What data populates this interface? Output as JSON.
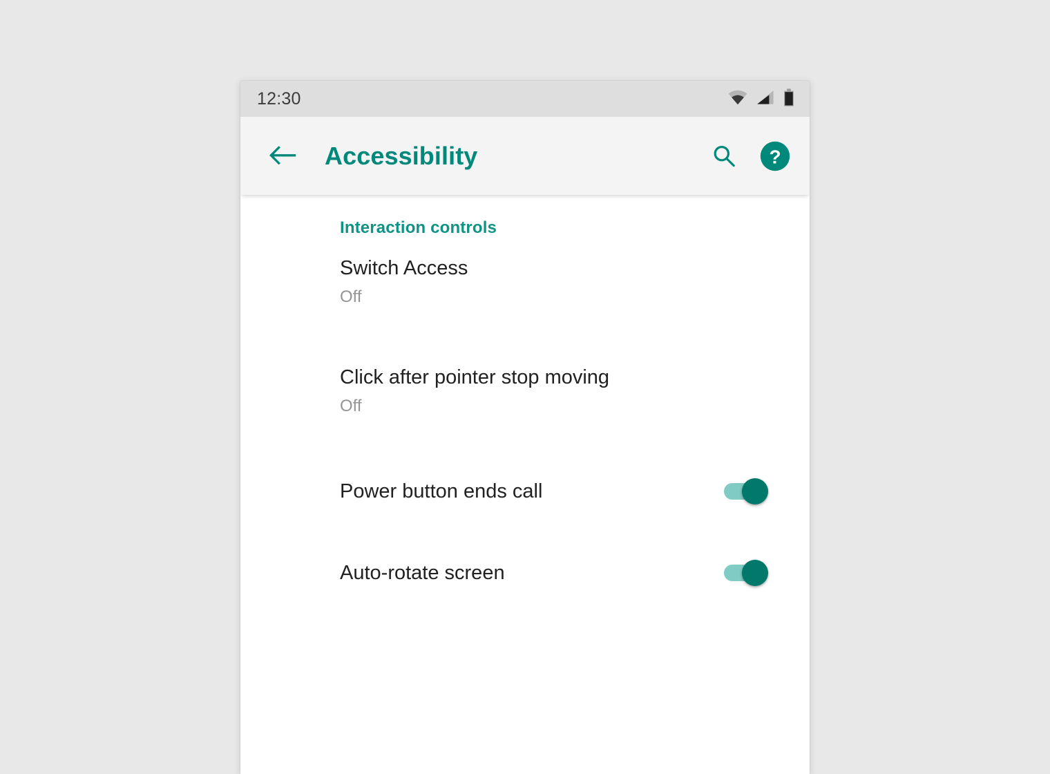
{
  "theme": {
    "accent": "#00897b",
    "accent_dark": "#00796b",
    "section_header_color": "#0f9384",
    "switch_track_on": "#80cbc4",
    "title_color": "#212121",
    "summary_color": "#949494",
    "status_bar_bg": "#dedede",
    "app_bar_bg": "#f4f4f4",
    "page_bg": "#e8e8e8",
    "content_bg": "#ffffff"
  },
  "status_bar": {
    "time": "12:30",
    "icons": [
      {
        "name": "wifi-icon",
        "label": "Wi-Fi"
      },
      {
        "name": "cellular-signal-icon",
        "label": "Cellular signal"
      },
      {
        "name": "battery-icon",
        "label": "Battery"
      }
    ]
  },
  "app_bar": {
    "back_label": "Navigate up",
    "title": "Accessibility",
    "actions": [
      {
        "name": "search-icon",
        "label": "Search"
      },
      {
        "name": "help-icon",
        "label": "Help"
      }
    ]
  },
  "content": {
    "section_header": "Interaction controls",
    "items": [
      {
        "title": "Switch Access",
        "summary": "Off",
        "control": "none",
        "name": "switch-access"
      },
      {
        "title": "Click after pointer stop moving",
        "summary": "Off",
        "control": "none",
        "name": "click-after-pointer-stop-moving"
      },
      {
        "title": "Power button ends call",
        "summary": "",
        "control": "switch",
        "switch_state": "on",
        "name": "power-button-ends-call"
      },
      {
        "title": "Auto-rotate screen",
        "summary": "",
        "control": "switch",
        "switch_state": "on",
        "name": "auto-rotate-screen"
      }
    ]
  }
}
